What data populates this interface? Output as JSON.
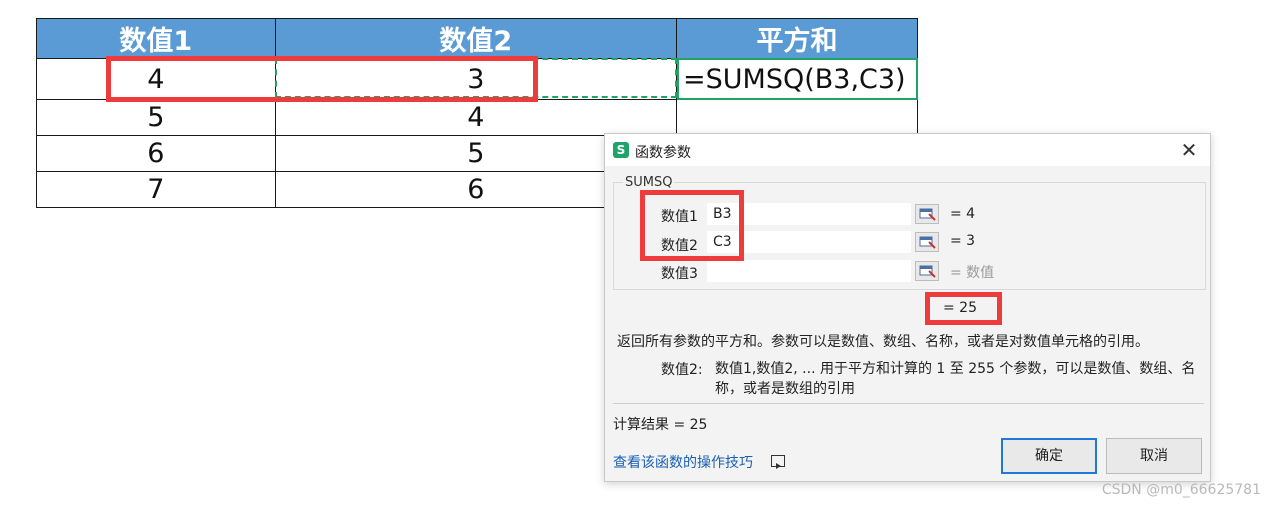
{
  "sheet": {
    "headers": [
      "数值1",
      "数值2",
      "平方和"
    ],
    "rows": [
      [
        "4",
        "3",
        "=SUMSQ(B3,C3)"
      ],
      [
        "5",
        "4",
        ""
      ],
      [
        "6",
        "5",
        ""
      ],
      [
        "7",
        "6",
        ""
      ]
    ]
  },
  "dialog": {
    "title": "函数参数",
    "app_icon": "S",
    "function_name": "SUMSQ",
    "args": [
      {
        "label": "数值1",
        "value": "B3",
        "result": "= 4",
        "result_placeholder": false
      },
      {
        "label": "数值2",
        "value": "C3",
        "result": "= 3",
        "result_placeholder": false
      },
      {
        "label": "数值3",
        "value": "",
        "result": "= 数值",
        "result_placeholder": true
      }
    ],
    "formula_result": "= 25",
    "description": "返回所有参数的平方和。参数可以是数值、数组、名称，或者是对数值单元格的引用。",
    "param_label": "数值2:",
    "param_desc": "数值1,数值2, ... 用于平方和计算的 1 至 255 个参数，可以是数值、数组、名称，或者是数组的引用",
    "calc_result": "计算结果 = 25",
    "tips_link": "查看该函数的操作技巧",
    "ok_label": "确定",
    "cancel_label": "取消"
  },
  "watermark": "CSDN @m0_66625781",
  "colors": {
    "header_bg": "#5b9bd5",
    "highlight": "#ee3b3b",
    "selection": "#21a366",
    "link": "#1a5fb4",
    "ok_border": "#1e78d6"
  }
}
